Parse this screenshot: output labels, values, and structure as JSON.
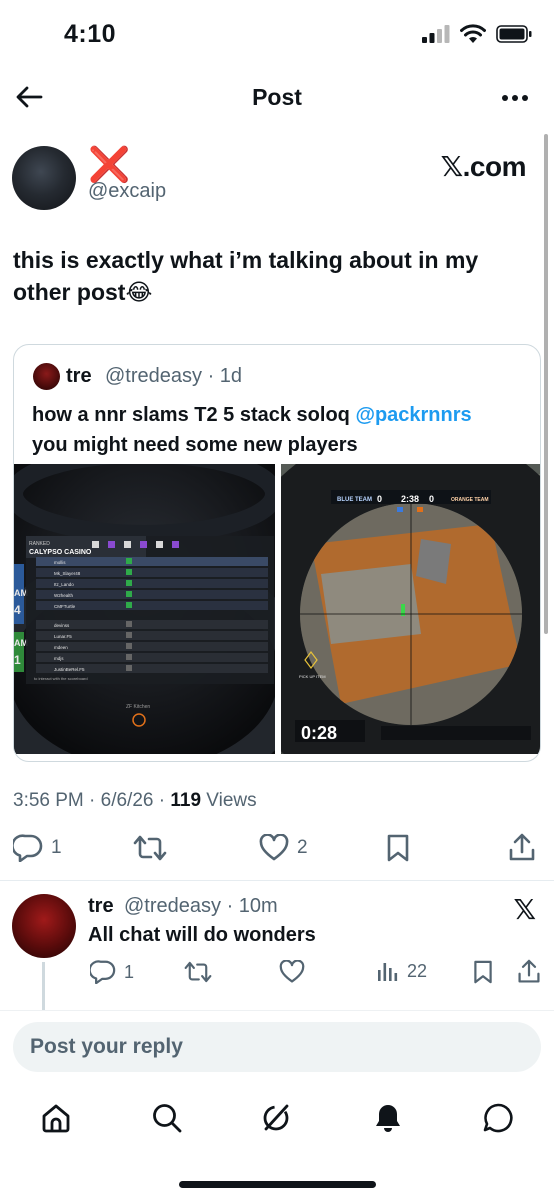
{
  "status_bar": {
    "time": "4:10"
  },
  "header": {
    "title": "Post"
  },
  "post": {
    "display_name_emoji": "❌",
    "handle": "@excaip",
    "source_logo": "𝕏.com",
    "text": "this is exactly what i’m talking about in my other post😂",
    "timestamp": "3:56 PM · 6/6/26 · ",
    "views_count": "119",
    "views_label": " Views",
    "actions": {
      "replies": "1",
      "reposts": "",
      "likes": "2"
    }
  },
  "quote": {
    "name": "tre",
    "handle_time": "@tredeasy · 1d",
    "text_main": "how a nnr slams  T2 5 stack soloq ",
    "mention": "@packrnnrs",
    "text_tail": "you might need some new players",
    "image1": {
      "ranked_label": "RANKED",
      "map_label": "CALYPSO CASINO",
      "players": [
        "mollis",
        "Mk_Slayer48",
        "Itz_Lando",
        "W2health",
        "CMFTurtle",
        "devinss",
        "Lunar.F5",
        "mdeen",
        "mdjs",
        "JustinBeRel.F5"
      ],
      "footer_hint": "to interact with the scoreboard",
      "kitchen_label": "ZF Kitchen",
      "side_letters": [
        "AM",
        "4",
        "AM",
        "1"
      ]
    },
    "image2": {
      "blue_team": "BLUE TEAM",
      "blue_score": "0",
      "timer": "2:38",
      "orange_score": "0",
      "orange_team": "ORANGE TEAM",
      "round_timer": "0:28",
      "pickup_label": "PICK UP ITEM"
    }
  },
  "reply": {
    "name": "tre",
    "handle_time": "@tredeasy · 10m",
    "text": "All chat will do wonders",
    "actions": {
      "replies": "1",
      "views": "22"
    }
  },
  "reply_box": {
    "placeholder": "Post your reply"
  },
  "icons": [
    "arrow-left-icon",
    "more-icon",
    "x-logo-icon",
    "reply-icon",
    "repost-icon",
    "heart-icon",
    "bookmark-icon",
    "share-icon",
    "views-icon",
    "home-icon",
    "search-icon",
    "grok-icon",
    "bell-icon",
    "messages-icon"
  ],
  "colors": {
    "link": "#1d9bf0",
    "secondary": "#536471",
    "text": "#0f1419",
    "error_red": "#e0202a"
  }
}
